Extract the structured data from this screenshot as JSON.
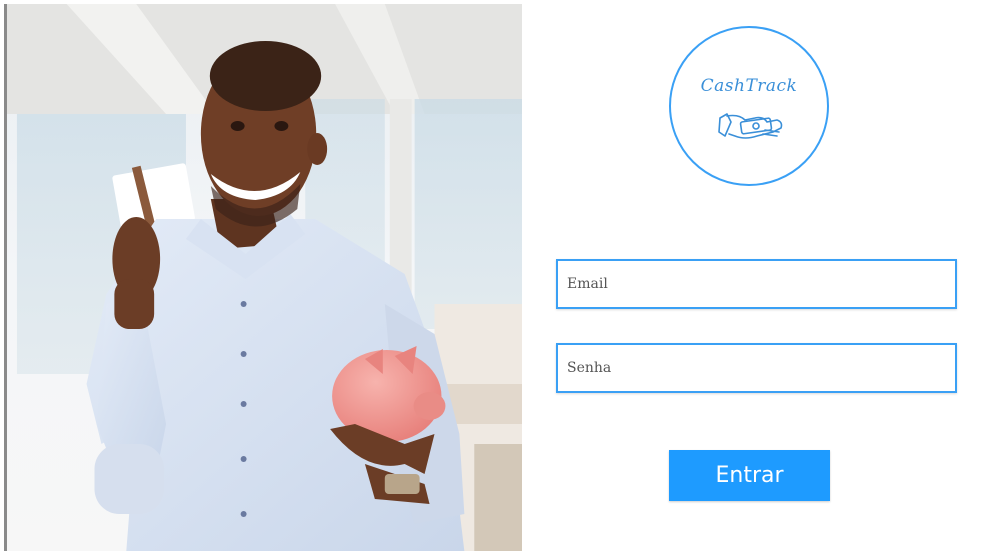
{
  "logo": {
    "brand_text": "CashTrack",
    "icon": "money-hand-icon",
    "accent_color": "#3aa0f5"
  },
  "form": {
    "email_placeholder": "Email",
    "password_placeholder": "Senha",
    "submit_label": "Entrar",
    "button_color": "#1e9bff"
  },
  "hero": {
    "image": "man-holding-card-and-piggy-bank"
  }
}
